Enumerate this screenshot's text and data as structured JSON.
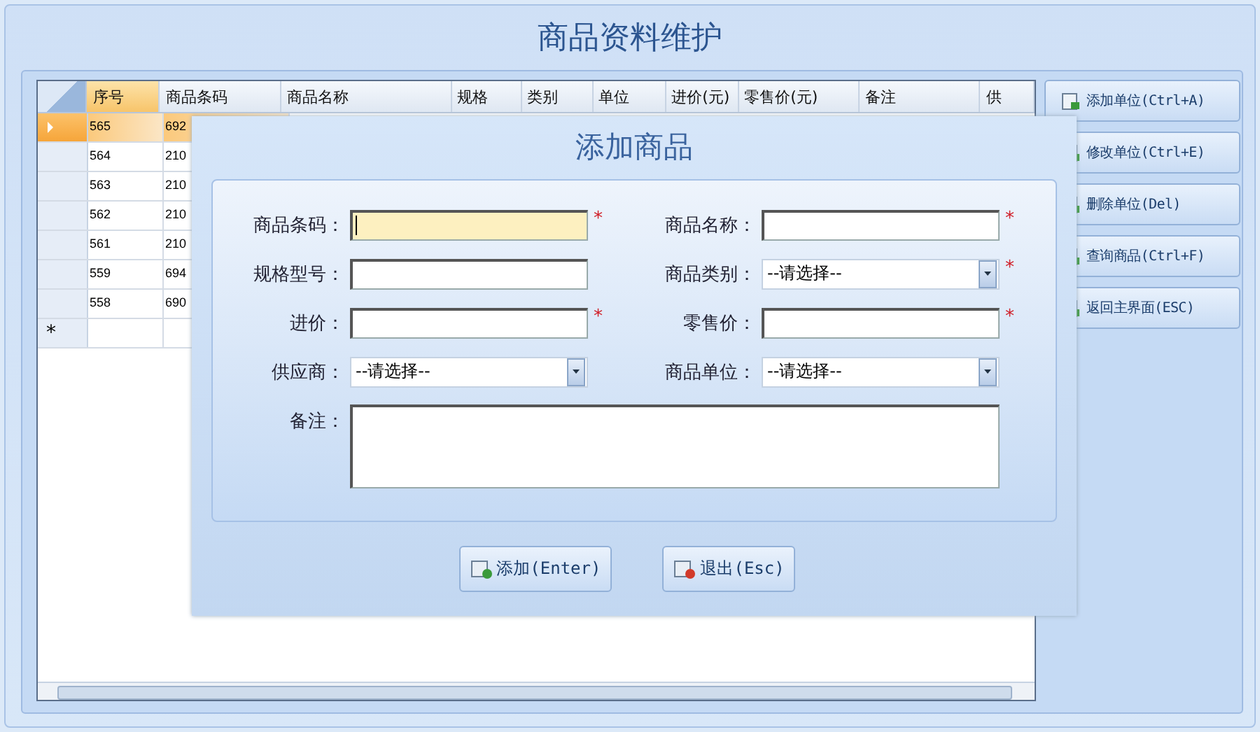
{
  "window": {
    "title": "商品资料维护"
  },
  "table": {
    "columns": [
      "序号",
      "商品条码",
      "商品名称",
      "规格",
      "类别",
      "单位",
      "进价(元)",
      "零售价(元)",
      "备注",
      "供"
    ],
    "rows": [
      {
        "selected": true,
        "cells": [
          "565",
          "692"
        ]
      },
      {
        "selected": false,
        "cells": [
          "564",
          "210"
        ]
      },
      {
        "selected": false,
        "cells": [
          "563",
          "210"
        ]
      },
      {
        "selected": false,
        "cells": [
          "562",
          "210"
        ]
      },
      {
        "selected": false,
        "cells": [
          "561",
          "210"
        ]
      },
      {
        "selected": false,
        "cells": [
          "559",
          "694"
        ]
      },
      {
        "selected": false,
        "cells": [
          "558",
          "690"
        ]
      }
    ],
    "new_row_marker": "*"
  },
  "side_buttons": [
    {
      "label": "添加单位(Ctrl+A)"
    },
    {
      "label": "修改单位(Ctrl+E)"
    },
    {
      "label": "删除单位(Del)"
    },
    {
      "label": "查询商品(Ctrl+F)"
    },
    {
      "label": "返回主界面(ESC)"
    }
  ],
  "dialog": {
    "title": "添加商品",
    "fields": [
      {
        "label": "商品条码：",
        "kind": "text",
        "required": true,
        "focused": true
      },
      {
        "label": "商品名称：",
        "kind": "text",
        "required": true,
        "focused": false
      },
      {
        "label": "规格型号：",
        "kind": "text",
        "required": false,
        "focused": false
      },
      {
        "label": "商品类别：",
        "kind": "select",
        "value": "--请选择--",
        "required": true,
        "focused": false
      },
      {
        "label": "进价：",
        "kind": "text",
        "required": true,
        "focused": false
      },
      {
        "label": "零售价：",
        "kind": "text",
        "required": true,
        "focused": false
      },
      {
        "label": "供应商：",
        "kind": "select",
        "value": "--请选择--",
        "required": false,
        "focused": false
      },
      {
        "label": "商品单位：",
        "kind": "select",
        "value": "--请选择--",
        "required": false,
        "focused": false
      },
      {
        "label": "备注：",
        "kind": "textarea",
        "required": false,
        "focused": false
      }
    ],
    "required_mark": "*",
    "buttons": [
      {
        "label": "添加(Enter)",
        "kind": "add"
      },
      {
        "label": "退出(Esc)",
        "kind": "exit"
      }
    ]
  }
}
